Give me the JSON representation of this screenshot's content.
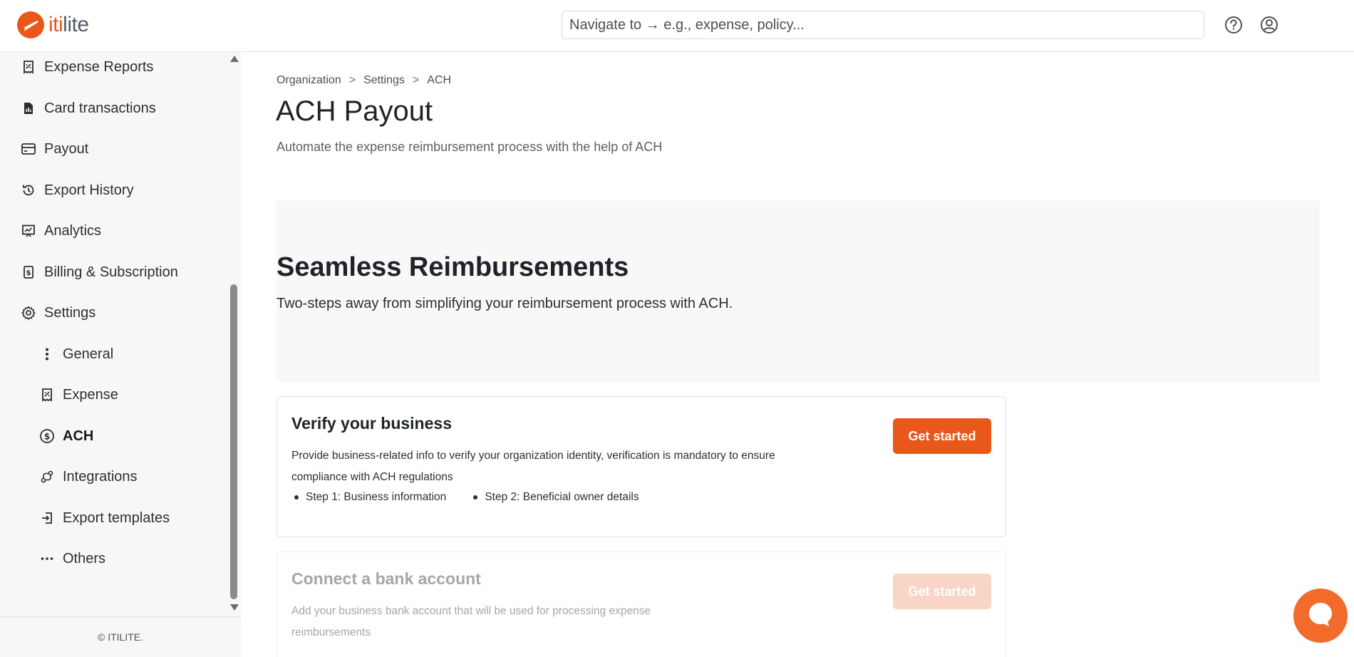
{
  "header": {
    "logo_prefix": "iti",
    "logo_suffix": "lite",
    "search_placeholder": "Navigate to → e.g., expense, policy...",
    "help_icon": "help-circle-icon",
    "profile_icon": "user-circle-icon"
  },
  "sidebar": {
    "items": [
      {
        "label": "Expense Reports",
        "icon": "receipt-icon"
      },
      {
        "label": "Card transactions",
        "icon": "card-transactions-icon"
      },
      {
        "label": "Payout",
        "icon": "credit-card-icon"
      },
      {
        "label": "Export History",
        "icon": "history-icon"
      },
      {
        "label": "Analytics",
        "icon": "analytics-icon"
      },
      {
        "label": "Billing & Subscription",
        "icon": "billing-icon"
      },
      {
        "label": "Settings",
        "icon": "gear-icon"
      }
    ],
    "sub_items": [
      {
        "label": "General",
        "icon": "vertical-dots-icon"
      },
      {
        "label": "Expense",
        "icon": "receipt-icon"
      },
      {
        "label": "ACH",
        "icon": "dollar-circle-icon",
        "active": true
      },
      {
        "label": "Integrations",
        "icon": "integrations-icon"
      },
      {
        "label": "Export templates",
        "icon": "export-icon"
      },
      {
        "label": "Others",
        "icon": "horizontal-dots-icon"
      }
    ],
    "footer": "© ITILITE."
  },
  "main": {
    "breadcrumb": [
      "Organization",
      "Settings",
      "ACH"
    ],
    "breadcrumb_sep": ">",
    "title": "ACH Payout",
    "subtitle": "Automate the expense reimbursement process with the help of ACH",
    "banner": {
      "title": "Seamless Reimbursements",
      "subtitle": "Two-steps away from simplifying your reimbursement process with ACH."
    },
    "cards": [
      {
        "title": "Verify your business",
        "description": "Provide business-related info to verify your organization identity, verification is mandatory to ensure compliance with ACH regulations",
        "steps": [
          "Step 1: Business information",
          "Step 2: Beneficial owner details"
        ],
        "button": "Get started",
        "enabled": true
      },
      {
        "title": "Connect a bank account",
        "description": "Add your business bank account that will be used for processing expense reimbursements",
        "button": "Get started",
        "enabled": false
      }
    ]
  },
  "colors": {
    "brand": "#e9571b",
    "brand_disabled": "#f8d5c6",
    "sidebar_bg": "#f7f7f7",
    "banner_bg": "#f8f8f8"
  },
  "chat_icon": "chat-bubble-icon"
}
